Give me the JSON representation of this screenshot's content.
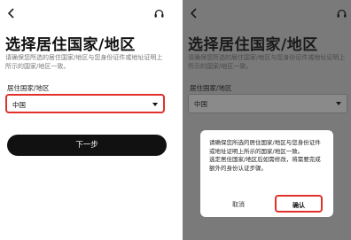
{
  "screen_left": {
    "back_icon": "chevron-left-icon",
    "help_icon": "headset-icon",
    "title": "选择居住国家/地区",
    "description": "请确保您所选的居住国家/地区与您身份证件或地址证明上所示的国家/地区一致。",
    "field_label": "居住国家/地区",
    "selected_country": "中国",
    "next_button": "下一步"
  },
  "screen_right": {
    "back_icon": "chevron-left-icon",
    "help_icon": "headset-icon",
    "title": "选择居住国家/地区",
    "description": "请确保您所选的居住国家/地区与您身份证件或地址证明上所示的国家/地区一致。",
    "field_label": "居住国家/地区",
    "selected_country": "中国",
    "dialog": {
      "message": "请确保您所选的居住国家/地区与您身份证件或地址证明上所示的国家/地区一致。",
      "note": "选定居住国家/地区后如需修改，将需要完成额外的身份认证步骤。",
      "cancel": "取消",
      "confirm": "确认"
    }
  },
  "colors": {
    "highlight": "#e0312b",
    "primary_button": "#111111",
    "overlay": "#7a7a7a"
  }
}
